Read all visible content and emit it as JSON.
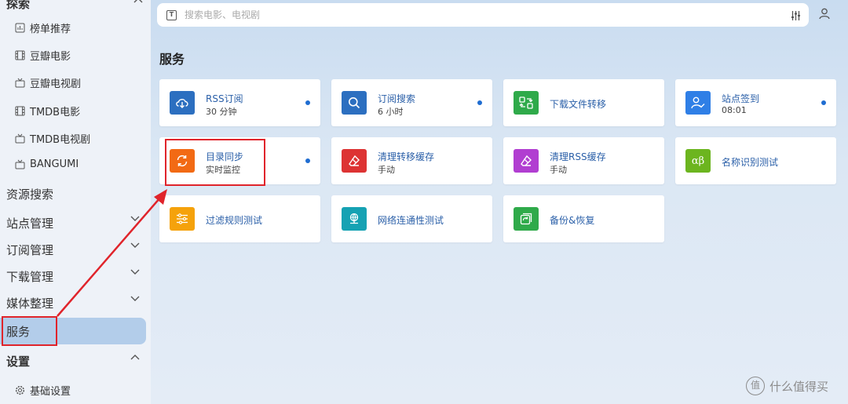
{
  "sidebar": {
    "top_section": "探索",
    "explore_items": [
      {
        "label": "榜单推荐",
        "icon": "chart-icon"
      },
      {
        "label": "豆瓣电影",
        "icon": "film-icon"
      },
      {
        "label": "豆瓣电视剧",
        "icon": "tv-icon"
      },
      {
        "label": "TMDB电影",
        "icon": "film-icon"
      },
      {
        "label": "TMDB电视剧",
        "icon": "tv-icon"
      },
      {
        "label": "BANGUMI",
        "icon": "tv-icon"
      }
    ],
    "resource_search": "资源搜索",
    "site_manage": "站点管理",
    "subscribe_manage": "订阅管理",
    "download_manage": "下载管理",
    "media_organize": "媒体整理",
    "service": "服务",
    "settings": "设置",
    "basic_settings": "基础设置"
  },
  "search": {
    "placeholder": "搜索电影、电视剧"
  },
  "page_title": "服务",
  "cards": [
    {
      "title": "RSS订阅",
      "sub": "30 分钟",
      "color": "#2c6fc0",
      "icon": "cloud-download-icon",
      "dot": true
    },
    {
      "title": "订阅搜索",
      "sub": "6 小时",
      "color": "#2c6fc0",
      "icon": "search-icon",
      "dot": true
    },
    {
      "title": "下载文件转移",
      "sub": "",
      "color": "#2faa4a",
      "icon": "transfer-icon",
      "dot": false
    },
    {
      "title": "站点签到",
      "sub": "08:01",
      "color": "#2f7fe6",
      "icon": "user-check-icon",
      "dot": true
    },
    {
      "title": "目录同步",
      "sub": "实时监控",
      "color": "#f26a14",
      "icon": "sync-icon",
      "dot": true
    },
    {
      "title": "清理转移缓存",
      "sub": "手动",
      "color": "#dd3333",
      "icon": "eraser-icon",
      "dot": false
    },
    {
      "title": "清理RSS缓存",
      "sub": "手动",
      "color": "#b13ed1",
      "icon": "eraser-icon",
      "dot": false
    },
    {
      "title": "名称识别测试",
      "sub": "",
      "color": "#6cb51f",
      "icon": "alpha-beta-icon",
      "dot": false
    },
    {
      "title": "过滤规则测试",
      "sub": "",
      "color": "#f5a20b",
      "icon": "sliders-icon",
      "dot": false
    },
    {
      "title": "网络连通性测试",
      "sub": "",
      "color": "#16a2b3",
      "icon": "network-icon",
      "dot": false
    },
    {
      "title": "备份&恢复",
      "sub": "",
      "color": "#2faa4a",
      "icon": "backup-icon",
      "dot": false
    }
  ],
  "watermark": "什么值得买",
  "watermark_icon": "值"
}
